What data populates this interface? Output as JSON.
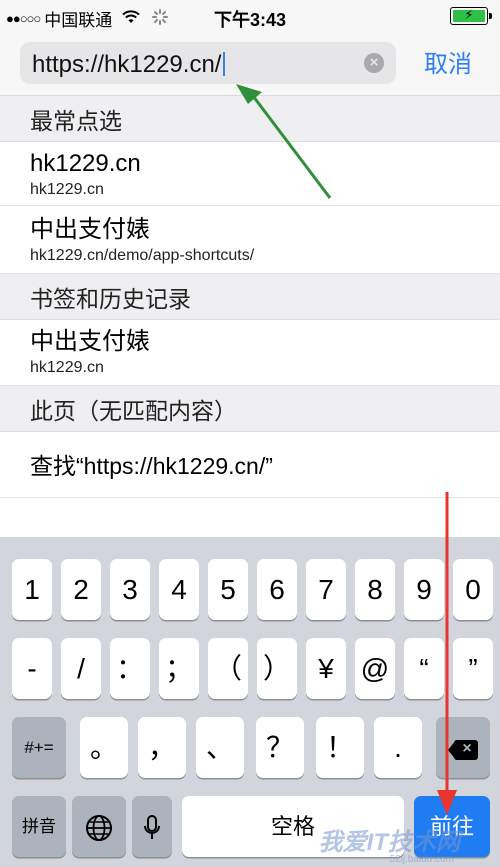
{
  "status_bar": {
    "signal": "●●○○○",
    "carrier": "中国联通",
    "time": "下午3:43",
    "battery_color": "#2ec14a"
  },
  "address_bar": {
    "url": "https://hk1229.cn/",
    "cancel_label": "取消",
    "clear_icon": "clear-circle-icon",
    "accent": "#2f7ef5"
  },
  "sections": {
    "top_hits": "最常点选",
    "bookmarks_history": "书签和历史记录",
    "on_page": "此页（无匹配内容）"
  },
  "top_hits": [
    {
      "title": "hk1229.cn",
      "url": "hk1229.cn"
    },
    {
      "title": "中出支付婊",
      "url": "hk1229.cn/demo/app-shortcuts/"
    }
  ],
  "bookmarks_history": [
    {
      "title": "中出支付婊",
      "url": "hk1229.cn"
    }
  ],
  "find_on_page": "查找“https://hk1229.cn/”",
  "keyboard": {
    "row1": [
      "1",
      "2",
      "3",
      "4",
      "5",
      "6",
      "7",
      "8",
      "9",
      "0"
    ],
    "row2": [
      "-",
      "/",
      "：",
      "；",
      "（",
      "）",
      "¥",
      "@",
      "“",
      "”"
    ],
    "row3": [
      "#+=",
      "。",
      "，",
      "、",
      "？",
      "！",
      "."
    ],
    "row4": {
      "pinyin": "拼音",
      "globe_icon": "globe-icon",
      "mic_icon": "microphone-icon",
      "space": "空格",
      "go": "前往"
    }
  },
  "watermark": {
    "text": "我爱IT技术网",
    "sub": "52ij.baidu.com"
  },
  "colors": {
    "arrow_green": "#2f8f3a",
    "arrow_red": "#e8352d",
    "go_key": "#1f7cf2"
  }
}
